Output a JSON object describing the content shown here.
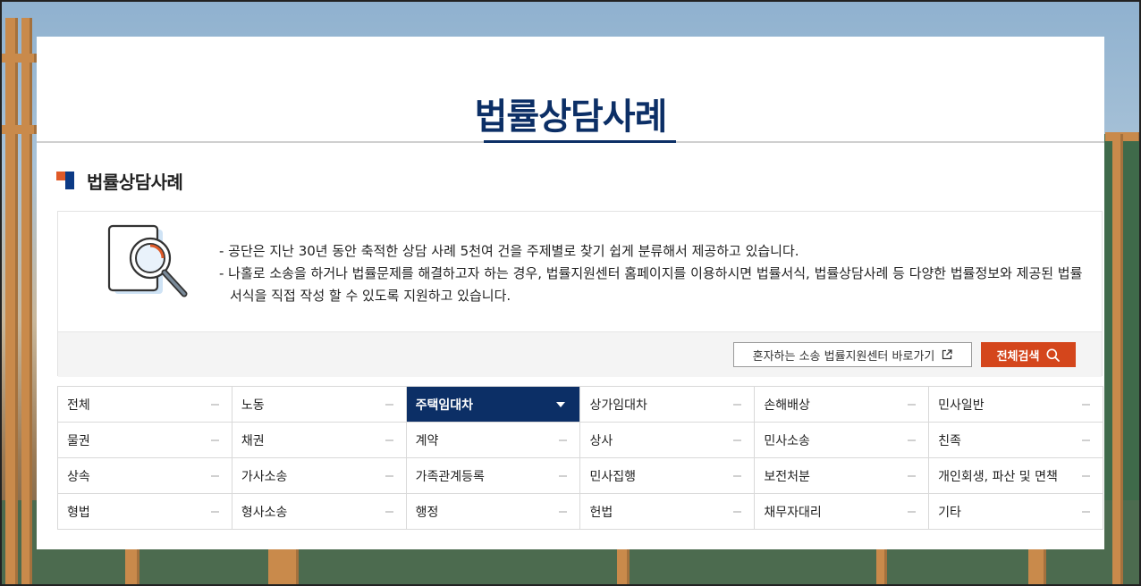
{
  "page": {
    "title": "법률상담사례"
  },
  "section": {
    "title": "법률상담사례"
  },
  "intro": {
    "lines": [
      "- 공단은 지난 30년 동안 축적한 상담 사례 5천여 건을 주제별로 찾기 쉽게 분류해서 제공하고 있습니다.",
      "- 나홀로 소송을 하거나 법률문제를 해결하고자 하는 경우, 법률지원센터 홈페이지를 이용하시면 법률서식, 법률상담사례 등 다양한 법률정보와 제공된 법률서식을 직접 작성 할 수 있도록 지원하고 있습니다."
    ],
    "icon": "document-magnifier-icon"
  },
  "actions": {
    "link_label": "혼자하는 소송 법률지원센터 바로가기",
    "link_icon": "external-link-icon",
    "search_label": "전체검색",
    "search_icon": "search-icon"
  },
  "categories": [
    {
      "label": "전체",
      "active": false
    },
    {
      "label": "노동",
      "active": false
    },
    {
      "label": "주택임대차",
      "active": true
    },
    {
      "label": "상가임대차",
      "active": false
    },
    {
      "label": "손해배상",
      "active": false
    },
    {
      "label": "민사일반",
      "active": false
    },
    {
      "label": "물권",
      "active": false
    },
    {
      "label": "채권",
      "active": false
    },
    {
      "label": "계약",
      "active": false
    },
    {
      "label": "상사",
      "active": false
    },
    {
      "label": "민사소송",
      "active": false
    },
    {
      "label": "친족",
      "active": false
    },
    {
      "label": "상속",
      "active": false
    },
    {
      "label": "가사소송",
      "active": false
    },
    {
      "label": "가족관계등록",
      "active": false
    },
    {
      "label": "민사집행",
      "active": false
    },
    {
      "label": "보전처분",
      "active": false
    },
    {
      "label": "개인회생, 파산 및 면책",
      "active": false
    },
    {
      "label": "형법",
      "active": false
    },
    {
      "label": "형사소송",
      "active": false
    },
    {
      "label": "행정",
      "active": false
    },
    {
      "label": "헌법",
      "active": false
    },
    {
      "label": "채무자대리",
      "active": false
    },
    {
      "label": "기타",
      "active": false
    }
  ],
  "colors": {
    "primary_navy": "#0c2f66",
    "accent_orange": "#d4461c"
  }
}
